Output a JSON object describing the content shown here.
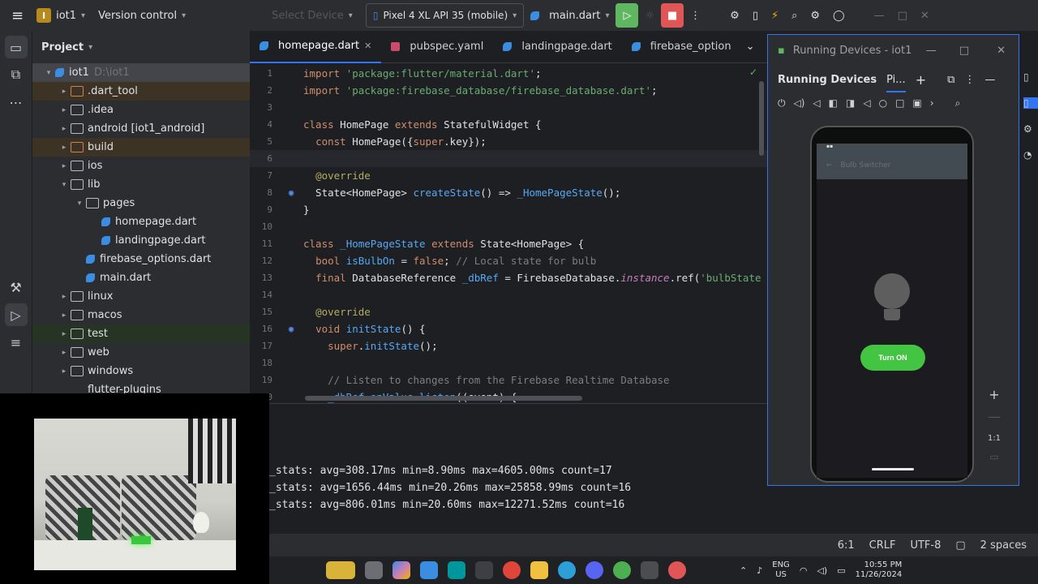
{
  "titlebar": {
    "project_badge": "I",
    "project_name": "iot1",
    "vcs": "Version control",
    "device_select": "Select Device",
    "device": "Pixel 4 XL API 35 (mobile)",
    "run_config": "main.dart"
  },
  "project_panel": {
    "title": "Project",
    "items": [
      {
        "label": "iot1",
        "extra": "D:\\iot1",
        "indent": 0,
        "arrow": "▾",
        "kind": "root"
      },
      {
        "label": ".dart_tool",
        "extra": "",
        "indent": 1,
        "arrow": "▸",
        "kind": "folder-orange"
      },
      {
        "label": ".idea",
        "extra": "",
        "indent": 1,
        "arrow": "▸",
        "kind": "folder"
      },
      {
        "label": "android [iot1_android]",
        "extra": "",
        "indent": 1,
        "arrow": "▸",
        "kind": "folder"
      },
      {
        "label": "build",
        "extra": "",
        "indent": 1,
        "arrow": "▸",
        "kind": "folder-orange"
      },
      {
        "label": "ios",
        "extra": "",
        "indent": 1,
        "arrow": "▸",
        "kind": "folder"
      },
      {
        "label": "lib",
        "extra": "",
        "indent": 1,
        "arrow": "▾",
        "kind": "folder"
      },
      {
        "label": "pages",
        "extra": "",
        "indent": 2,
        "arrow": "▾",
        "kind": "folder"
      },
      {
        "label": "homepage.dart",
        "extra": "",
        "indent": 3,
        "arrow": "",
        "kind": "dart"
      },
      {
        "label": "landingpage.dart",
        "extra": "",
        "indent": 3,
        "arrow": "",
        "kind": "dart"
      },
      {
        "label": "firebase_options.dart",
        "extra": "",
        "indent": 2,
        "arrow": "",
        "kind": "dart"
      },
      {
        "label": "main.dart",
        "extra": "",
        "indent": 2,
        "arrow": "",
        "kind": "dart"
      },
      {
        "label": "linux",
        "extra": "",
        "indent": 1,
        "arrow": "▸",
        "kind": "folder"
      },
      {
        "label": "macos",
        "extra": "",
        "indent": 1,
        "arrow": "▸",
        "kind": "folder"
      },
      {
        "label": "test",
        "extra": "",
        "indent": 1,
        "arrow": "▸",
        "kind": "folder-green"
      },
      {
        "label": "web",
        "extra": "",
        "indent": 1,
        "arrow": "▸",
        "kind": "folder"
      },
      {
        "label": "windows",
        "extra": "",
        "indent": 1,
        "arrow": "▸",
        "kind": "folder"
      },
      {
        "label": "flutter-plugins",
        "extra": "",
        "indent": 1,
        "arrow": "",
        "kind": "file"
      }
    ]
  },
  "editor": {
    "tabs": [
      {
        "label": "homepage.dart",
        "active": true
      },
      {
        "label": "pubspec.yaml",
        "active": false
      },
      {
        "label": "landingpage.dart",
        "active": false
      },
      {
        "label": "firebase_option",
        "active": false
      }
    ],
    "lines": [
      "import 'package:flutter/material.dart';",
      "import 'package:firebase_database/firebase_database.dart';",
      "",
      "class HomePage extends StatefulWidget {",
      "  const HomePage({super.key});",
      "",
      "  @override",
      "  State<HomePage> createState() => _HomePageState();",
      "}",
      "",
      "class _HomePageState extends State<HomePage> {",
      "  bool isBulbOn = false; // Local state for bulb",
      "  final DatabaseReference _dbRef = FirebaseDatabase.instance.ref('bulbState",
      "",
      "  @override",
      "  void initState() {",
      "    super.initState();",
      "",
      "    // Listen to changes from the Firebase Realtime Database",
      "    _dbRef.onValue.listen((event) {"
    ]
  },
  "console": {
    "lines": [
      "_stats: avg=308.17ms min=8.90ms max=4605.00ms count=17",
      "_stats: avg=1656.44ms min=20.26ms max=25858.99ms count=16",
      "_stats: avg=806.01ms min=20.60ms max=12271.52ms count=16"
    ]
  },
  "running_devices": {
    "window_title": "Running Devices - iot1",
    "panel_title": "Running Devices",
    "device_tab": "Pi...",
    "zoom_label": "1:1"
  },
  "phone_app": {
    "appbar_title": "Bulb Switcher",
    "button_label": "Turn ON"
  },
  "statusbar": {
    "position": "6:1",
    "line_sep": "CRLF",
    "encoding": "UTF-8",
    "indent": "2 spaces"
  },
  "taskbar": {
    "lang": "ENG",
    "region": "US",
    "time": "10:55 PM",
    "date": "11/26/2024"
  },
  "colors": {
    "accent": "#3574f0",
    "run_green": "#5fb85f",
    "stop_red": "#e05555",
    "app_button_green": "#43c443"
  }
}
